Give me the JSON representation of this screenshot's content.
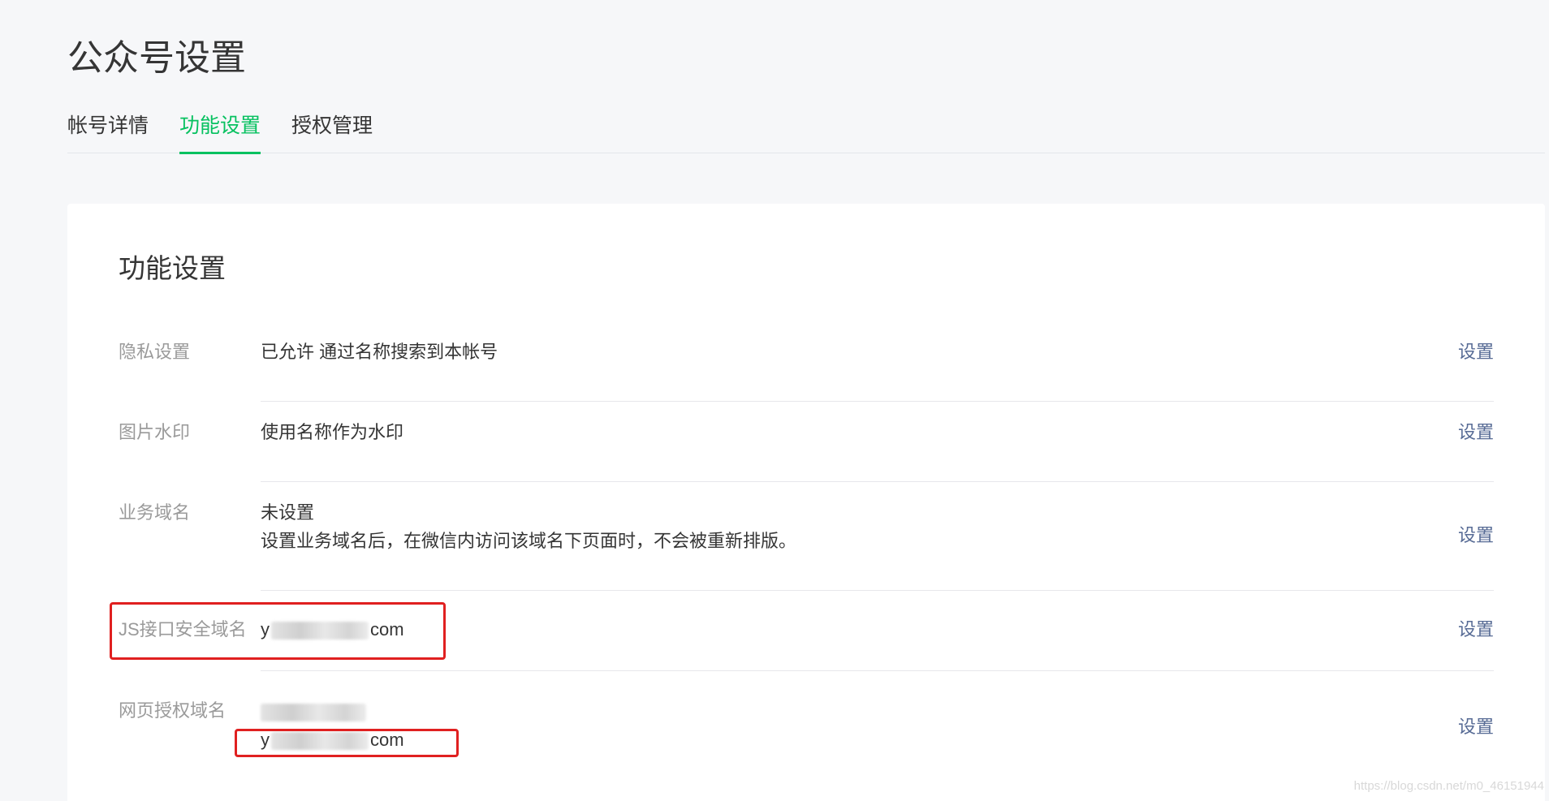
{
  "page": {
    "title": "公众号设置"
  },
  "tabs": [
    {
      "label": "帐号详情",
      "active": false
    },
    {
      "label": "功能设置",
      "active": true
    },
    {
      "label": "授权管理",
      "active": false
    }
  ],
  "card": {
    "title": "功能设置",
    "rows": [
      {
        "label": "隐私设置",
        "value": "已允许 通过名称搜索到本帐号",
        "action": "设置"
      },
      {
        "label": "图片水印",
        "value": "使用名称作为水印",
        "action": "设置"
      },
      {
        "label": "业务域名",
        "value": "未设置",
        "note": "设置业务域名后，在微信内访问该域名下页面时，不会被重新排版。",
        "action": "设置"
      },
      {
        "label": "JS接口安全域名",
        "value_prefix": "y",
        "value_suffix": "com",
        "action": "设置"
      },
      {
        "label": "网页授权域名",
        "value2_prefix": "y",
        "value2_suffix": "com",
        "action": "设置"
      }
    ]
  },
  "watermark": "https://blog.csdn.net/m0_46151944",
  "colors": {
    "accent": "#07c160",
    "link": "#576b95",
    "annotation": "#e02020"
  }
}
